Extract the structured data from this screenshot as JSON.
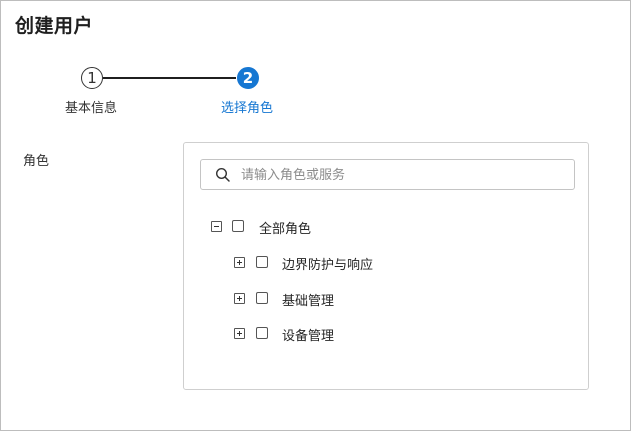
{
  "page": {
    "title": "创建用户"
  },
  "steps": [
    {
      "number": "1",
      "label": "基本信息",
      "state": "done"
    },
    {
      "number": "2",
      "label": "选择角色",
      "state": "active"
    }
  ],
  "colors": {
    "accent": "#1677d2",
    "text": "#262626"
  },
  "form": {
    "role_label": "角色",
    "search": {
      "placeholder": "请输入角色或服务",
      "value": ""
    },
    "tree": {
      "root": {
        "label": "全部角色",
        "expanded": true,
        "checked": false
      },
      "children": [
        {
          "label": "边界防护与响应",
          "expanded": false,
          "checked": false
        },
        {
          "label": "基础管理",
          "expanded": false,
          "checked": false
        },
        {
          "label": "设备管理",
          "expanded": false,
          "checked": false
        }
      ]
    }
  }
}
